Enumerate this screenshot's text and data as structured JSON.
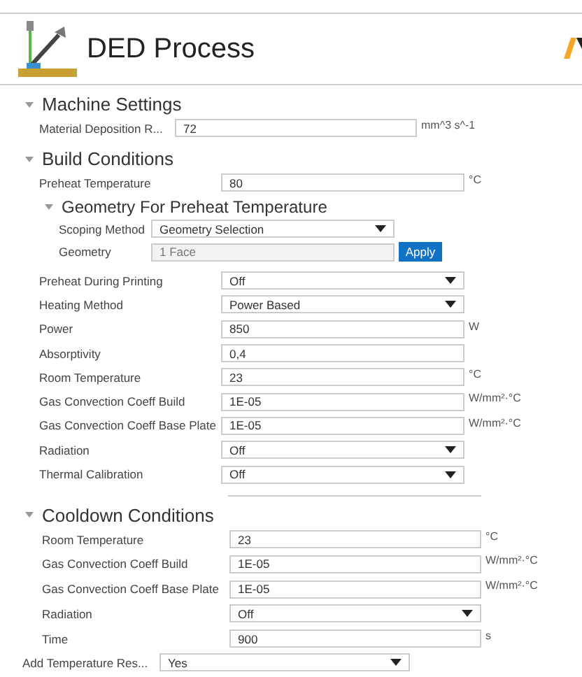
{
  "header": {
    "title": "DED Process"
  },
  "sections": [
    {
      "title": "Machine Settings",
      "expanded": true,
      "rows": [
        {
          "kind": "input",
          "label": "Material Deposition R...",
          "value": "72",
          "unit": "mm^3 s^-1"
        }
      ]
    },
    {
      "title": "Build Conditions",
      "expanded": true,
      "rows": [
        {
          "kind": "input",
          "label": "Preheat Temperature",
          "value": "80",
          "unit": "°C"
        }
      ],
      "subsection": {
        "title": "Geometry For Preheat Temperature",
        "expanded": true,
        "rows": [
          {
            "kind": "select",
            "label": "Scoping Method",
            "value": "Geometry Selection"
          },
          {
            "kind": "readonly",
            "label": "Geometry",
            "value": "1 Face",
            "action": "Apply"
          }
        ]
      },
      "more_rows": [
        {
          "kind": "select",
          "label": "Preheat During Printing",
          "value": "Off"
        },
        {
          "kind": "select",
          "label": "Heating Method",
          "value": "Power Based"
        },
        {
          "kind": "input",
          "label": "Power",
          "value": "850",
          "unit": "W"
        },
        {
          "kind": "input",
          "label": "Absorptivity",
          "value": "0,4"
        },
        {
          "kind": "input",
          "label": "Room Temperature",
          "value": "23",
          "unit": "°C"
        },
        {
          "kind": "input",
          "label": "Gas Convection Coeff Build",
          "value": "1E-05",
          "unit": "W/mm²·°C"
        },
        {
          "kind": "input",
          "label": "Gas Convection Coeff Base Plate",
          "value": "1E-05",
          "unit": "W/mm²·°C"
        },
        {
          "kind": "select",
          "label": "Radiation",
          "value": "Off"
        },
        {
          "kind": "select",
          "label": "Thermal Calibration",
          "value": "Off"
        }
      ]
    },
    {
      "title": "Cooldown Conditions",
      "expanded": true,
      "rows": [
        {
          "kind": "input",
          "label": "Room Temperature",
          "value": "23",
          "unit": "°C"
        },
        {
          "kind": "input",
          "label": "Gas Convection Coeff Build",
          "value": "1E-05",
          "unit": "W/mm²·°C"
        },
        {
          "kind": "input",
          "label": "Gas Convection Coeff Base Plate",
          "value": "1E-05",
          "unit": "W/mm²·°C"
        },
        {
          "kind": "select",
          "label": "Radiation",
          "value": "Off"
        },
        {
          "kind": "input",
          "label": "Time",
          "value": "900",
          "unit": "s"
        }
      ]
    }
  ],
  "footer_row": {
    "kind": "select",
    "label": "Add Temperature Res...",
    "value": "Yes"
  }
}
